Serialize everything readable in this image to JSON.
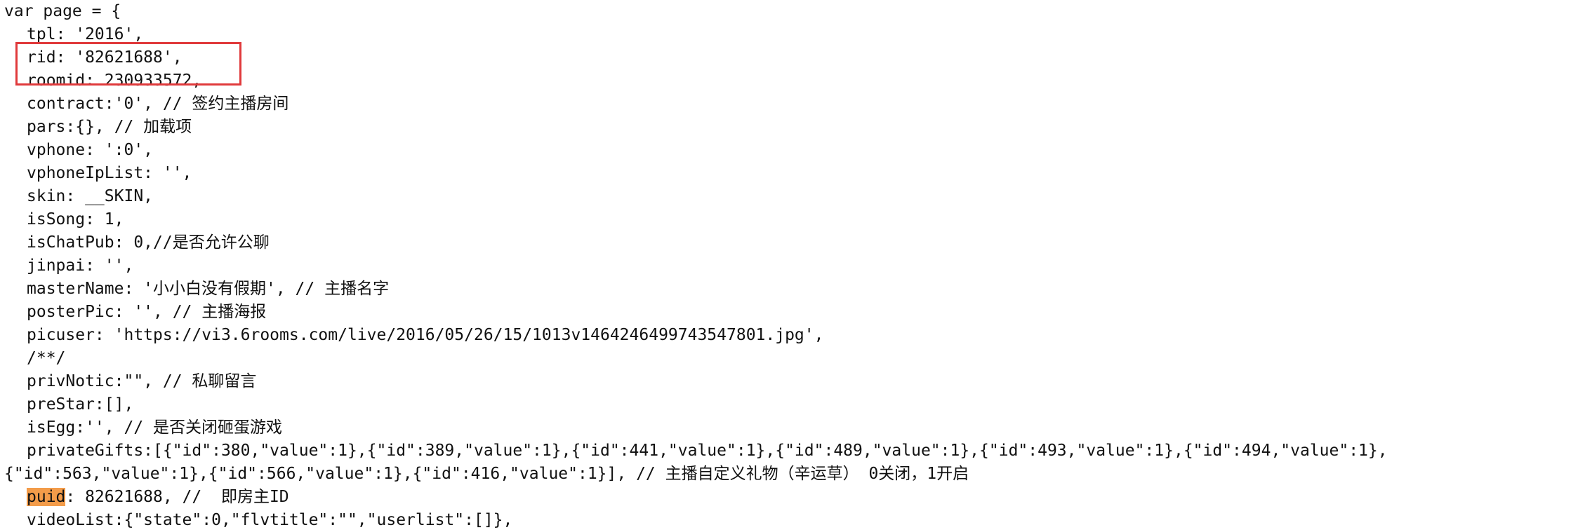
{
  "colors": {
    "text": "#111111",
    "background": "#ffffff",
    "highlight_box": "#e0393b",
    "search_match": "#f39c4a"
  },
  "lines": [
    "var page = {",
    "tpl: '2016',",
    "rid: '82621688',",
    "roomid: 230933572,",
    "contract:'0', // 签约主播房间",
    "pars:{}, // 加载项",
    "vphone: ':0',",
    "vphoneIpList: '',",
    "skin: __SKIN,",
    "isSong: 1,",
    "isChatPub: 0,//是否允许公聊",
    "jinpai: '',",
    "masterName: '小小白没有假期', // 主播名字",
    "posterPic: '', // 主播海报",
    "picuser: 'https://vi3.6rooms.com/live/2016/05/26/15/1013v1464246499743547801.jpg',",
    "/**/",
    "privNotic:\"\", // 私聊留言",
    "preStar:[],",
    "isEgg:'', // 是否关闭砸蛋游戏",
    "privateGifts:[{\"id\":380,\"value\":1},{\"id\":389,\"value\":1},{\"id\":441,\"value\":1},{\"id\":489,\"value\":1},{\"id\":493,\"value\":1},{\"id\":494,\"value\":1},",
    "{\"id\":563,\"value\":1},{\"id\":566,\"value\":1},{\"id\":416,\"value\":1}], // 主播自定义礼物（辛运草） 0关闭，1开启",
    ": 82621688, //  即房主ID",
    "videoList:{\"state\":0,\"flvtitle\":\"\",\"userlist\":[]},"
  ],
  "search_term": "puid"
}
